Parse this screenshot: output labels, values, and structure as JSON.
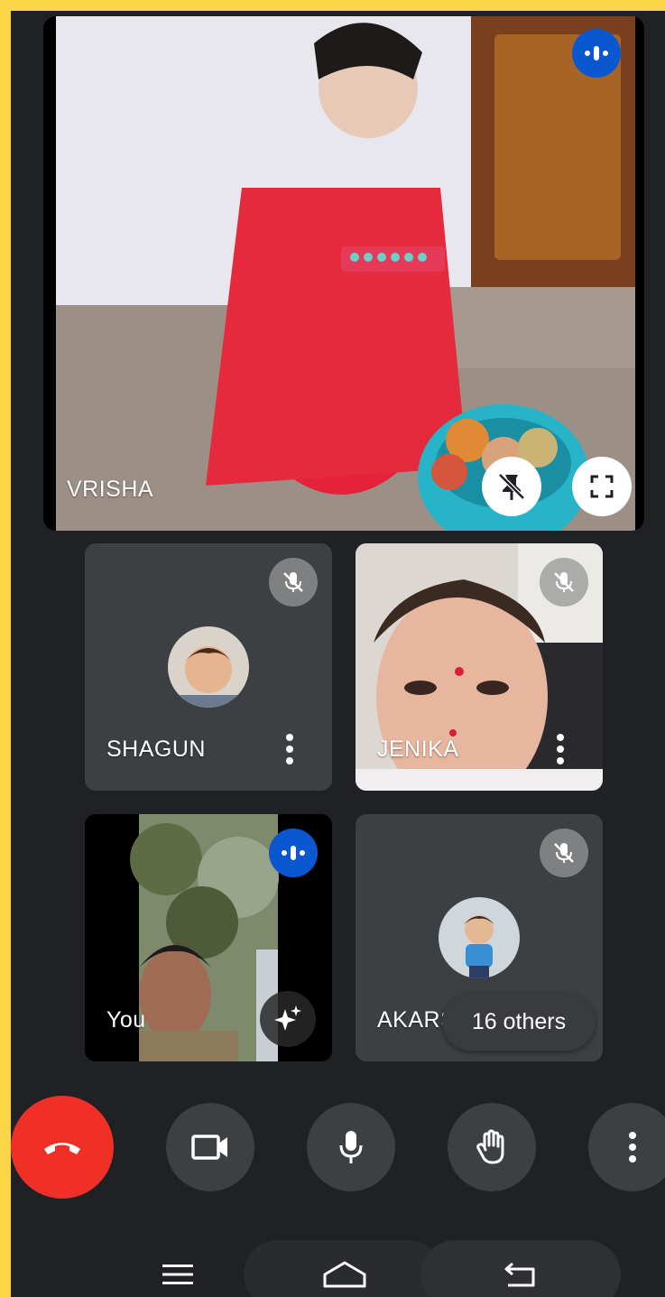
{
  "participants": {
    "main": {
      "name": "VRISHA"
    },
    "tiles": [
      {
        "name": "SHAGUN"
      },
      {
        "name": "JENIKA"
      },
      {
        "name": "You"
      },
      {
        "name": "AKARS"
      }
    ],
    "others_label": "16 others"
  },
  "colors": {
    "background": "#202124",
    "tile": "#3c4043",
    "end_call": "#f03027",
    "speaking": "#0b57d0",
    "frame": "#f9d547"
  },
  "icons": {
    "speaking": "audio-wave-icon",
    "muted": "mic-off-icon",
    "unpin": "unpin-icon",
    "fullscreen": "fullscreen-icon",
    "more": "more-vertical-icon",
    "effects": "sparkle-icon",
    "end_call": "phone-hangup-icon",
    "camera": "video-camera-icon",
    "mic": "microphone-icon",
    "raise_hand": "hand-icon",
    "menu": "menu-icon",
    "home": "home-icon",
    "back": "back-icon"
  }
}
